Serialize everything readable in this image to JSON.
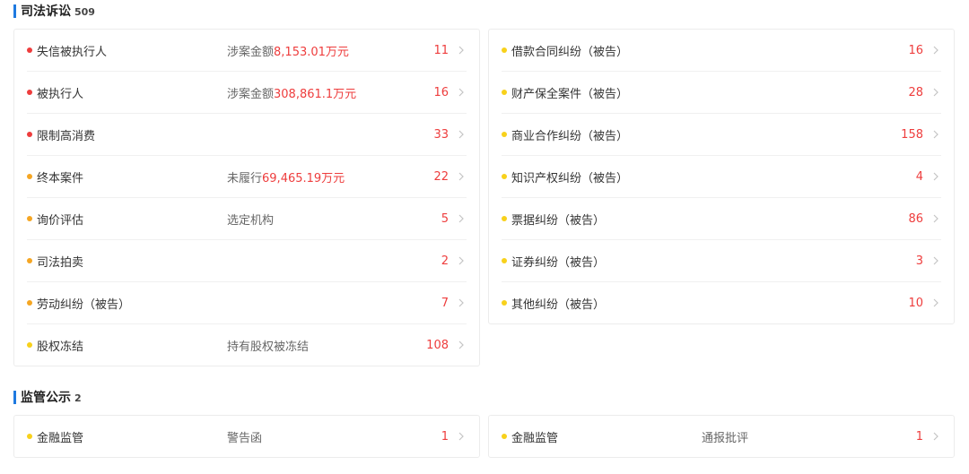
{
  "judicial": {
    "title": "司法诉讼",
    "count": "509",
    "left_items": [
      {
        "label": "失信被执行人",
        "dot": "red",
        "desc_prefix": "涉案金额",
        "desc_amount": "8,153.01万元",
        "count": "11"
      },
      {
        "label": "被执行人",
        "dot": "red",
        "desc_prefix": "涉案金额",
        "desc_amount": "308,861.1万元",
        "count": "16"
      },
      {
        "label": "限制高消费",
        "dot": "red",
        "desc_prefix": "",
        "desc_amount": "",
        "count": "33"
      },
      {
        "label": "终本案件",
        "dot": "orange",
        "desc_prefix": "未履行",
        "desc_amount": "69,465.19万元",
        "count": "22"
      },
      {
        "label": "询价评估",
        "dot": "orange",
        "desc_prefix": "选定机构",
        "desc_amount": "",
        "count": "5"
      },
      {
        "label": "司法拍卖",
        "dot": "orange",
        "desc_prefix": "",
        "desc_amount": "",
        "count": "2"
      },
      {
        "label": "劳动纠纷（被告）",
        "dot": "orange",
        "desc_prefix": "",
        "desc_amount": "",
        "count": "7"
      },
      {
        "label": "股权冻结",
        "dot": "yellow",
        "desc_prefix": "持有股权被冻结",
        "desc_amount": "",
        "count": "108"
      }
    ],
    "right_items": [
      {
        "label": "借款合同纠纷（被告）",
        "dot": "yellow",
        "count": "16"
      },
      {
        "label": "财产保全案件（被告）",
        "dot": "yellow",
        "count": "28"
      },
      {
        "label": "商业合作纠纷（被告）",
        "dot": "yellow",
        "count": "158"
      },
      {
        "label": "知识产权纠纷（被告）",
        "dot": "yellow",
        "count": "4"
      },
      {
        "label": "票据纠纷（被告）",
        "dot": "yellow",
        "count": "86"
      },
      {
        "label": "证券纠纷（被告）",
        "dot": "yellow",
        "count": "3"
      },
      {
        "label": "其他纠纷（被告）",
        "dot": "yellow",
        "count": "10"
      }
    ]
  },
  "regulatory": {
    "title": "监管公示",
    "count": "2",
    "left_item": {
      "label": "金融监管",
      "dot": "yellow",
      "desc": "警告函",
      "count": "1"
    },
    "right_item": {
      "label": "金融监管",
      "dot": "yellow",
      "desc": "通报批评",
      "count": "1"
    }
  },
  "colors": {
    "accent": "#1f7ae0",
    "red": "#ee3d3d",
    "orange": "#f5a623",
    "yellow": "#f8d11b"
  },
  "icons": {
    "row_arrow": "chevron-right-icon"
  }
}
